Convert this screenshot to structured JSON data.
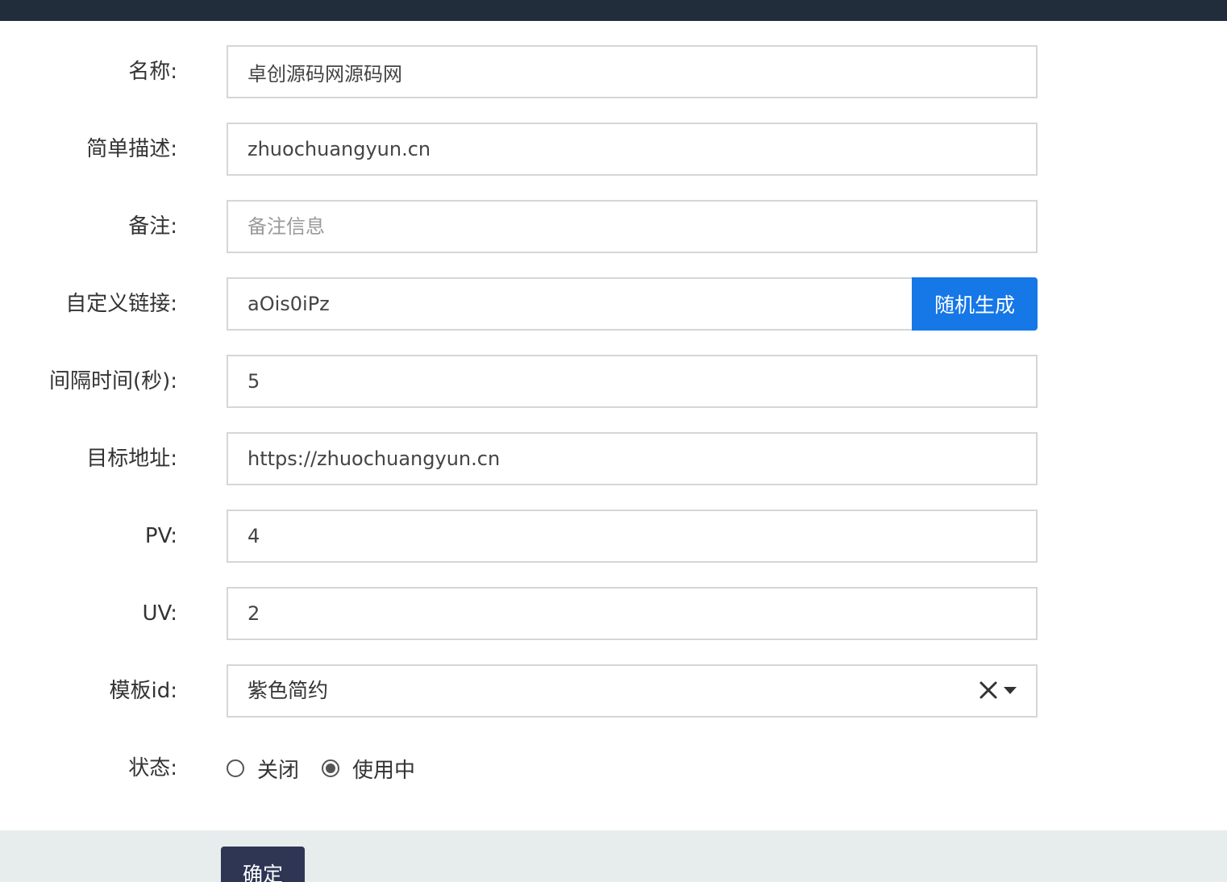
{
  "form": {
    "name": {
      "label": "名称:",
      "value": "卓创源码网源码网"
    },
    "description": {
      "label": "简单描述:",
      "value": "zhuochuangyun.cn"
    },
    "remark": {
      "label": "备注:",
      "value": "",
      "placeholder": "备注信息"
    },
    "custom_link": {
      "label": "自定义链接:",
      "value": "aOis0iPz",
      "button_label": "随机生成"
    },
    "interval": {
      "label": "间隔时间(秒):",
      "value": "5"
    },
    "target_url": {
      "label": "目标地址:",
      "value": "https://zhuochuangyun.cn"
    },
    "pv": {
      "label": "PV:",
      "value": "4"
    },
    "uv": {
      "label": "UV:",
      "value": "2"
    },
    "template": {
      "label": "模板id:",
      "selected": "紫色简约",
      "clear_icon": "close-icon",
      "arrow_icon": "caret-down-icon"
    },
    "status": {
      "label": "状态:",
      "options": [
        {
          "label": "关闭",
          "checked": false
        },
        {
          "label": "使用中",
          "checked": true
        }
      ]
    }
  },
  "footer": {
    "confirm_label": "确定"
  },
  "colors": {
    "topbar": "#222d3c",
    "primary_button": "#1677e6",
    "confirm_button": "#2e3654",
    "footer_bg": "#e7ecec"
  }
}
